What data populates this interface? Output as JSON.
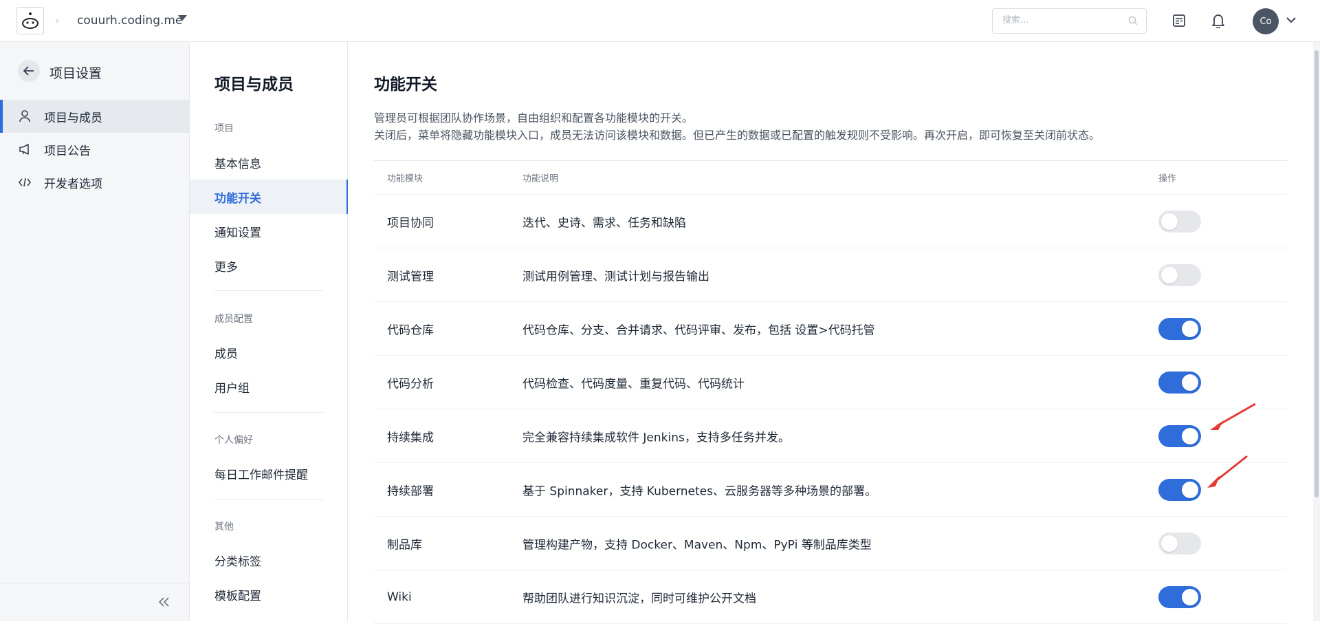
{
  "topbar": {
    "project_name": "couurh.coding.me",
    "search_placeholder": "搜索...",
    "avatar_initials": "Co"
  },
  "sidebar": {
    "title": "项目设置",
    "items": [
      {
        "label": "项目与成员",
        "icon": "user-icon",
        "active": true
      },
      {
        "label": "项目公告",
        "icon": "megaphone-icon",
        "active": false
      },
      {
        "label": "开发者选项",
        "icon": "code-icon",
        "active": false
      }
    ]
  },
  "subnav": {
    "title": "项目与成员",
    "groups": [
      {
        "label": "项目",
        "items": [
          "基本信息",
          "功能开关",
          "通知设置",
          "更多"
        ]
      },
      {
        "label": "成员配置",
        "items": [
          "成员",
          "用户组"
        ]
      },
      {
        "label": "个人偏好",
        "items": [
          "每日工作邮件提醒"
        ]
      },
      {
        "label": "其他",
        "items": [
          "分类标签",
          "模板配置"
        ]
      }
    ],
    "active_item": "功能开关"
  },
  "main": {
    "title": "功能开关",
    "desc_line1": "管理员可根据团队协作场景，自由组织和配置各功能模块的开关。",
    "desc_line2": "关闭后，菜单将隐藏功能模块入口，成员无法访问该模块和数据。但已产生的数据或已配置的触发规则不受影响。再次开启，即可恢复至关闭前状态。",
    "table": {
      "headers": [
        "功能模块",
        "功能说明",
        "操作"
      ],
      "rows": [
        {
          "module": "项目协同",
          "desc": "迭代、史诗、需求、任务和缺陷",
          "enabled": false
        },
        {
          "module": "测试管理",
          "desc": "测试用例管理、测试计划与报告输出",
          "enabled": false
        },
        {
          "module": "代码仓库",
          "desc": "代码仓库、分支、合并请求、代码评审、发布，包括 设置>代码托管",
          "enabled": true
        },
        {
          "module": "代码分析",
          "desc": "代码检查、代码度量、重复代码、代码统计",
          "enabled": true
        },
        {
          "module": "持续集成",
          "desc": "完全兼容持续集成软件 Jenkins，支持多任务并发。",
          "enabled": true
        },
        {
          "module": "持续部署",
          "desc": "基于 Spinnaker，支持 Kubernetes、云服务器等多种场景的部署。",
          "enabled": true
        },
        {
          "module": "制品库",
          "desc": "管理构建产物，支持 Docker、Maven、Npm、PyPi 等制品库类型",
          "enabled": false
        },
        {
          "module": "Wiki",
          "desc": "帮助团队进行知识沉淀，同时可维护公开文档",
          "enabled": true
        }
      ]
    }
  },
  "colors": {
    "accent": "#2f6ddb",
    "annotation_arrow": "#e53935"
  }
}
